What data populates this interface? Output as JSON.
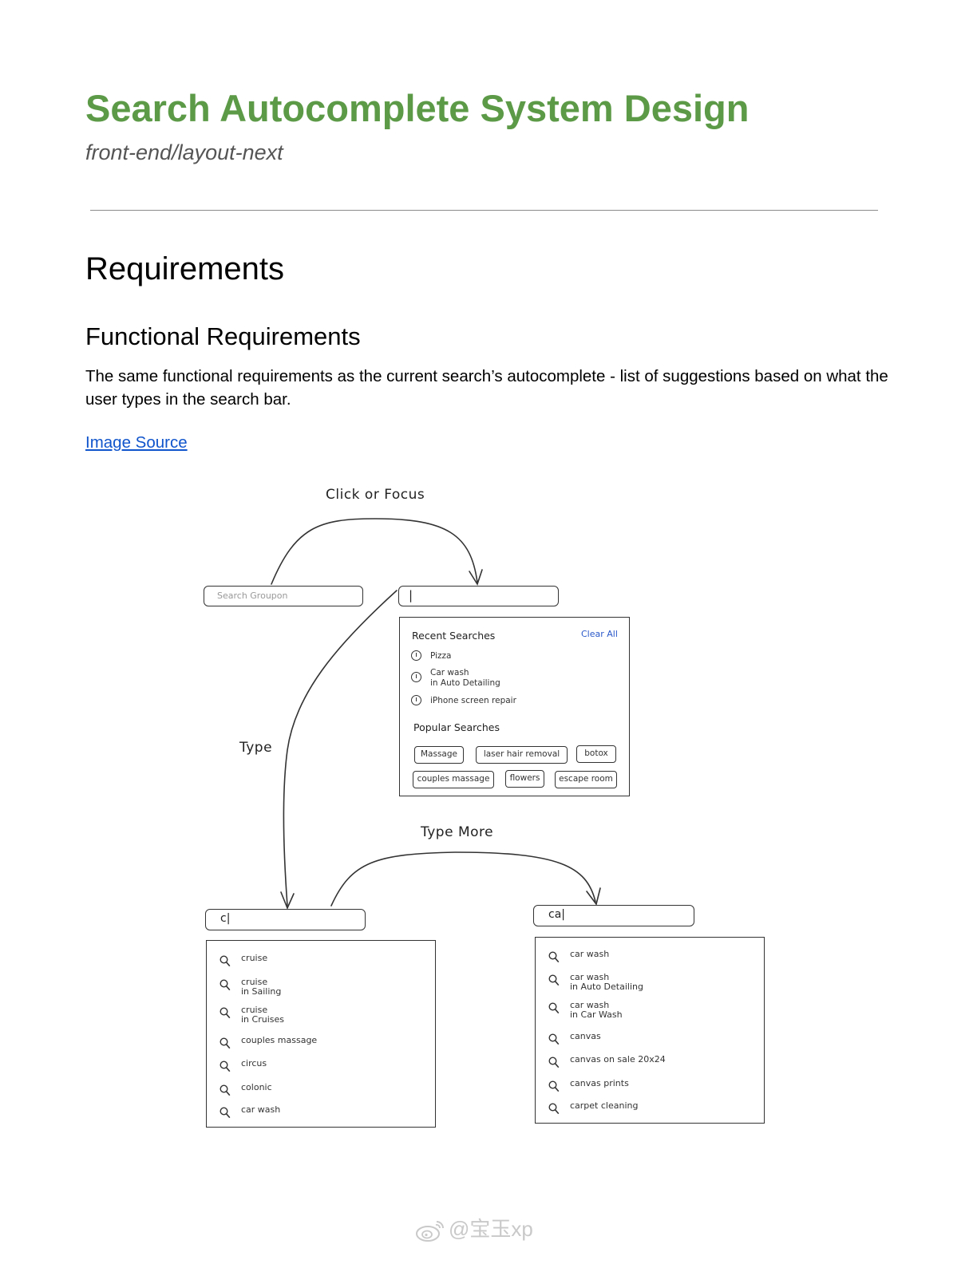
{
  "doc": {
    "title": "Search Autocomplete System Design",
    "subtitle": "front-end/layout-next",
    "h1": "Requirements",
    "h2": "Functional Requirements",
    "paragraph": "The same functional requirements as the current search’s autocomplete - list of suggestions based on what the user types in the search bar.",
    "link": "Image Source"
  },
  "diagram": {
    "click_label": "Click or Focus",
    "type_label": "Type",
    "type_more_label": "Type More",
    "search_placeholder": "Search Groupon",
    "focused_value": "|",
    "typed_c": "c|",
    "typed_ca": "ca|",
    "recent": {
      "title": "Recent Searches",
      "clear": "Clear All",
      "items": [
        {
          "line1": "Pizza",
          "line2": ""
        },
        {
          "line1": "Car wash",
          "line2": "in Auto Detailing"
        },
        {
          "line1": "iPhone screen repair",
          "line2": ""
        }
      ]
    },
    "popular": {
      "title": "Popular Searches",
      "chips_row1": [
        "Massage",
        "laser hair removal",
        "botox"
      ],
      "chips_row2": [
        "couples massage",
        "flowers",
        "escape room"
      ]
    },
    "suggest_c": [
      {
        "line1": "cruise",
        "line2": ""
      },
      {
        "line1": "cruise",
        "line2": "in Sailing"
      },
      {
        "line1": "cruise",
        "line2": "in Cruises"
      },
      {
        "line1": "couples massage",
        "line2": ""
      },
      {
        "line1": "circus",
        "line2": ""
      },
      {
        "line1": "colonic",
        "line2": ""
      },
      {
        "line1": "car wash",
        "line2": ""
      }
    ],
    "suggest_ca": [
      {
        "line1": "car wash",
        "line2": ""
      },
      {
        "line1": "car wash",
        "line2": "in Auto Detailing"
      },
      {
        "line1": "car wash",
        "line2": "in Car Wash"
      },
      {
        "line1": "canvas",
        "line2": ""
      },
      {
        "line1": "canvas on sale 20x24",
        "line2": ""
      },
      {
        "line1": "canvas prints",
        "line2": ""
      },
      {
        "line1": "carpet cleaning",
        "line2": ""
      }
    ]
  },
  "watermark": "@宝玉xp",
  "colors": {
    "title": "#5c9a47",
    "link": "#1155cc",
    "clear_all": "#2a58c9"
  }
}
